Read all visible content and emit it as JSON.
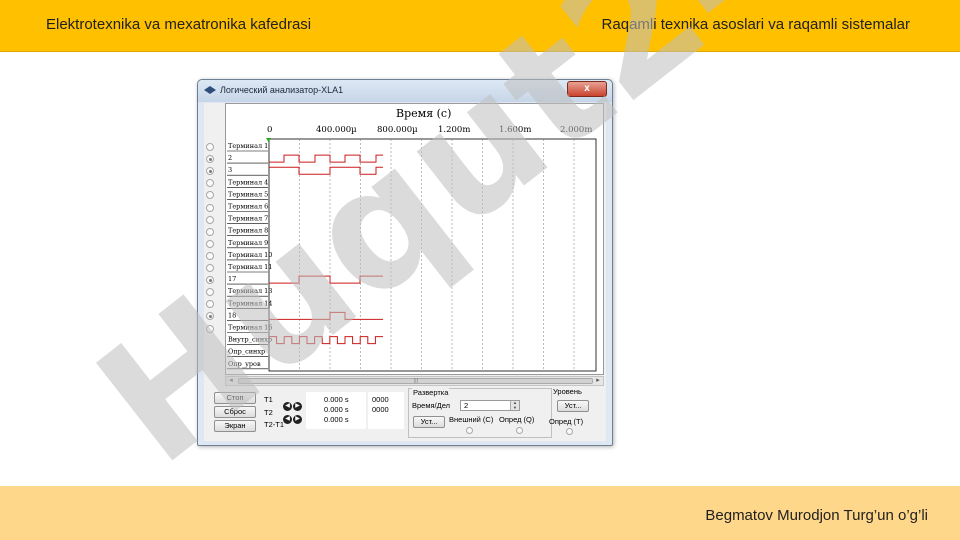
{
  "slide": {
    "header_left": "Elektrotexnika va mexatronika kafedrasi",
    "header_right": "Raqamli texnika asoslari va raqamli sistemalar",
    "footer_right": "Begmatov Murodjon Turg’un o’g’li",
    "watermark_text": "Huqut24",
    "colors": {
      "header": "#ffc000",
      "footer": "#ffd78a",
      "watermark_purple": "#d8c9f4",
      "watermark_gray": "#bfbfbf"
    }
  },
  "window": {
    "title": "Логический анализатор-XLA1",
    "close_label": "x"
  },
  "plot": {
    "axis_title": "Время (с)",
    "ticks": [
      "0",
      "400.000µ",
      "800.000µ",
      "1.200m",
      "1.600m",
      "2.000m"
    ],
    "channels": [
      "Терминал 1",
      "2",
      "3",
      "Терминал 4",
      "Терминал 5",
      "Терминал 6",
      "Терминал 7",
      "Терминал 8",
      "Терминал 9",
      "Терминал 10",
      "Терминал 11",
      "17",
      "Терминал 13",
      "Терминал 14",
      "18",
      "Терминал 16",
      "Внутр_синхр",
      "Опр_синхр",
      "Опр_уров"
    ],
    "channel_radio_on": [
      false,
      true,
      true,
      false,
      false,
      false,
      false,
      false,
      false,
      false,
      false,
      true,
      false,
      false,
      true,
      false
    ],
    "signal_color": "#cc1a1a"
  },
  "controls": {
    "stop_label": "Стоп",
    "reset_label": "Сброс",
    "screen_label": "Экран",
    "t1_label": "T1",
    "t2_label": "T2",
    "t2t1_label": "T2-T1",
    "t1_time": "0.000 s",
    "t2_time": "0.000 s",
    "t2t1_time": "0.000 s",
    "t1_code": "0000",
    "t2_code": "0000",
    "sweep_title": "Развертка",
    "time_div_label": "Время/Дел",
    "time_div_value": "2",
    "set_label": "Уст...",
    "external_label": "Внешний (C)",
    "defined_q_label": "Опред (Q)",
    "level_title": "Уровень",
    "level_set_label": "Уст...",
    "defined_t_label": "Опред (T)"
  }
}
